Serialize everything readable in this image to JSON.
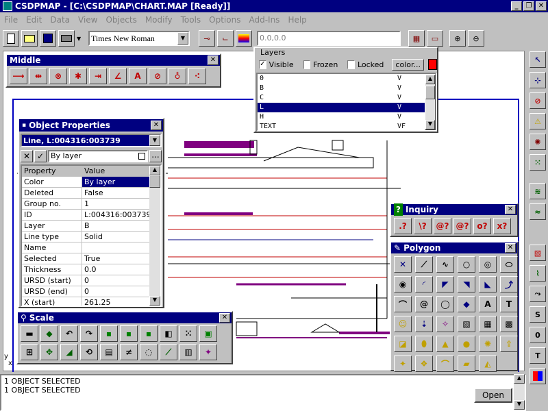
{
  "window": {
    "title": "CSDPMAP - [C:\\CSDPMAP\\CHART.MAP [Ready]]",
    "min": "_",
    "restore": "❐",
    "close": "✕"
  },
  "menu": [
    "File",
    "Edit",
    "Data",
    "View",
    "Objects",
    "Modify",
    "Tools",
    "Options",
    "Add-Ins",
    "Help"
  ],
  "toolbar": {
    "font": "Times New Roman",
    "coords": "0.0,0.0"
  },
  "layers": {
    "title": "Layers",
    "visible_label": "Visible",
    "frozen_label": "Frozen",
    "locked_label": "Locked",
    "color_label": "color...",
    "color_value": "#ff0000",
    "rows": [
      {
        "name": "0",
        "flag": "V"
      },
      {
        "name": "B",
        "flag": "V"
      },
      {
        "name": "C",
        "flag": "V"
      },
      {
        "name": "L",
        "flag": "V"
      },
      {
        "name": "H",
        "flag": "V"
      },
      {
        "name": "TEXT",
        "flag": "VF"
      }
    ],
    "selected_index": 3
  },
  "middle": {
    "title": "Middle",
    "tools": [
      "mid-line",
      "mid-perp",
      "mid-circle",
      "mid-cross",
      "mid-end",
      "mid-angle",
      "mid-text",
      "mid-slash",
      "mid-node",
      "mid-point"
    ]
  },
  "object_properties": {
    "title": "Object Properties",
    "selected": "Line, L:004316:003739",
    "layer_field": "By layer",
    "header": {
      "name": "Property",
      "value": "Value"
    },
    "rows": [
      {
        "name": "Color",
        "value": "By layer"
      },
      {
        "name": "Deleted",
        "value": "False"
      },
      {
        "name": "Group no.",
        "value": "1"
      },
      {
        "name": "ID",
        "value": "L:004316:003739"
      },
      {
        "name": "Layer",
        "value": "B"
      },
      {
        "name": "Line type",
        "value": "Solid"
      },
      {
        "name": "Name",
        "value": ""
      },
      {
        "name": "Selected",
        "value": "True"
      },
      {
        "name": "Thickness",
        "value": "0.0"
      },
      {
        "name": "URSD (start)",
        "value": "0"
      },
      {
        "name": "URSD (end)",
        "value": "0"
      },
      {
        "name": "X (start)",
        "value": "261.25"
      }
    ]
  },
  "scale": {
    "title": "Scale"
  },
  "inquiry": {
    "title": "Inquiry",
    "buttons": [
      ".?",
      "\\?",
      "@?",
      "@?",
      "o?",
      "x?"
    ]
  },
  "polygon": {
    "title": "Polygon"
  },
  "status": {
    "line1": "1 OBJECT SELECTED",
    "line2": "1 OBJECT SELECTED",
    "open_label": "Open"
  },
  "axis": {
    "y": "y",
    "x": "x"
  },
  "side_letters": [
    "S",
    "0",
    "T"
  ]
}
